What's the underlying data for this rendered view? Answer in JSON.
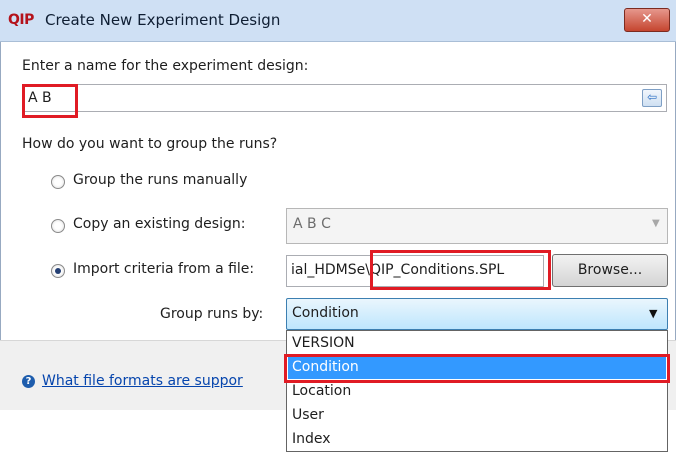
{
  "window": {
    "logo": "QIP",
    "title": "Create New Experiment Design",
    "close_glyph": "✕"
  },
  "form": {
    "name_prompt": "Enter a name for the experiment design:",
    "name_value": "A B",
    "group_prompt": "How do you want to group the runs?",
    "options": [
      {
        "label": "Group the runs manually",
        "checked": false
      },
      {
        "label": "Copy an existing design:",
        "checked": false
      },
      {
        "label": "Import criteria from a file:",
        "checked": true
      }
    ],
    "copy_design_value": "A B C",
    "file_path_value": "ial_HDMSe\\QIP_Conditions.SPL",
    "browse_label": "Browse...",
    "group_by_label": "Group runs by:",
    "group_by_value": "Condition",
    "group_by_options": [
      "VERSION",
      "Condition",
      "Location",
      "User",
      "Index"
    ],
    "group_by_highlighted": "Condition"
  },
  "footer": {
    "help_link": "What file formats are suppor"
  },
  "colors": {
    "highlight_box": "#e01b24",
    "selection": "#3399ff"
  }
}
